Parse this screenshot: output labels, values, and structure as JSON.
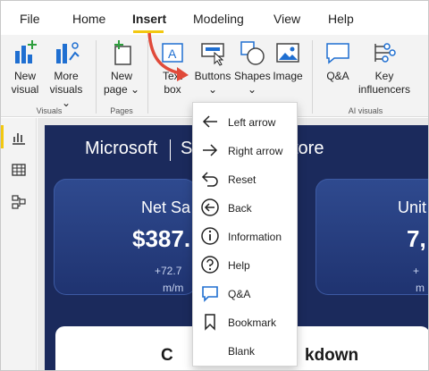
{
  "menu": {
    "tabs": [
      "File",
      "Home",
      "Insert",
      "Modeling",
      "View",
      "Help"
    ],
    "active_tab": "Insert"
  },
  "ribbon": {
    "new_visual": [
      "New",
      "visual"
    ],
    "more_visuals": [
      "More",
      "visuals"
    ],
    "new_page": [
      "New",
      "page"
    ],
    "text_box": [
      "Text",
      "box"
    ],
    "buttons": "Buttons",
    "shapes": "Shapes",
    "image": "Image",
    "qa": "Q&A",
    "key_influencers": [
      "Key",
      "influencers"
    ],
    "groups": {
      "visuals": "Visuals",
      "pages": "Pages",
      "ai_visuals": "AI visuals"
    }
  },
  "rail": {
    "items": [
      "report-view-icon",
      "data-view-icon",
      "model-view-icon"
    ]
  },
  "report": {
    "brand_left": "Microsoft",
    "brand_right_prefix": "S",
    "brand_right_suffix": "tore",
    "kpis": [
      {
        "title": "Net Sa",
        "value": "$387.",
        "delta": "+72.7",
        "sub": "m/m"
      },
      {
        "title": "Unit",
        "value": "7,",
        "delta": "+",
        "sub": "m"
      }
    ],
    "bottom_title_left": "C",
    "bottom_title_right": "kdown"
  },
  "buttons_menu": {
    "items": [
      {
        "label": "Left arrow",
        "icon": "left-arrow-icon"
      },
      {
        "label": "Right arrow",
        "icon": "right-arrow-icon"
      },
      {
        "label": "Reset",
        "icon": "reset-icon"
      },
      {
        "label": "Back",
        "icon": "back-icon"
      },
      {
        "label": "Information",
        "icon": "information-icon"
      },
      {
        "label": "Help",
        "icon": "help-icon"
      },
      {
        "label": "Q&A",
        "icon": "qa-icon"
      },
      {
        "label": "Bookmark",
        "icon": "bookmark-icon"
      },
      {
        "label": "Blank",
        "icon": "blank-icon"
      }
    ]
  },
  "colors": {
    "accent_yellow": "#f2c811",
    "icon_blue": "#1f6fd1",
    "annotation_red": "#e04a3a",
    "report_navy": "#1b2a5c"
  }
}
